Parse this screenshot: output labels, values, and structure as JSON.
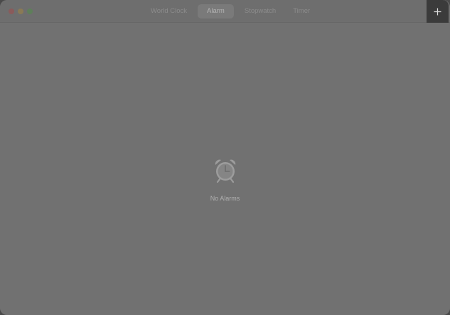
{
  "window": {
    "traffic_lights": [
      {
        "name": "close",
        "color": "#8a5b5b"
      },
      {
        "name": "minimize",
        "color": "#8a7a55"
      },
      {
        "name": "maximize",
        "color": "#5e7f5a"
      }
    ]
  },
  "tabs": [
    {
      "label": "World Clock",
      "active": false
    },
    {
      "label": "Alarm",
      "active": true
    },
    {
      "label": "Stopwatch",
      "active": false
    },
    {
      "label": "Timer",
      "active": false
    }
  ],
  "toolbar": {
    "add_icon": "plus-icon"
  },
  "main": {
    "empty_icon": "alarm-clock-icon",
    "empty_label": "No Alarms"
  },
  "colors": {
    "window_bg": "#717171",
    "add_button_bg": "#3b3b3b",
    "icon_color": "#9c9c9c"
  }
}
